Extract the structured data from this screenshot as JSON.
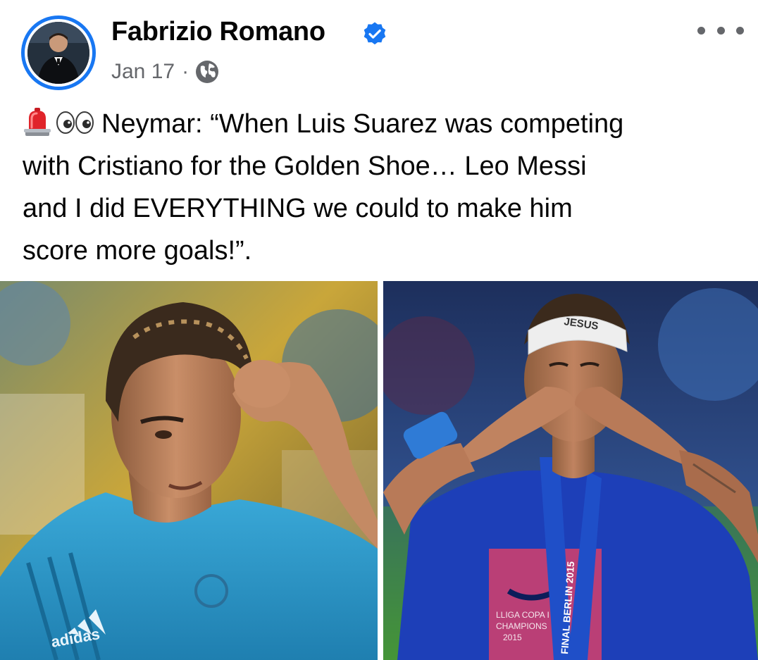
{
  "post": {
    "author": {
      "name": "Fabrizio Romano",
      "verified": true
    },
    "meta": {
      "date": "Jan 17",
      "separator": "·",
      "audience_icon": "globe-icon"
    },
    "more_icon": "more-options-icon",
    "text": {
      "emojis": [
        "siren-emoji",
        "eyes-emoji"
      ],
      "line1": "Neymar: “When Luis Suarez was competing",
      "line2": "with Cristiano for the Golden Shoe… Leo Messi",
      "line3": "and I did EVERYTHING we could to make him",
      "line4": "score more goals!”."
    },
    "photos": {
      "left": {
        "subject": "player-in-light-blue-kit-photo",
        "shirt_brand": "adidas"
      },
      "right": {
        "subject": "player-blowing-kiss-with-medal-photo",
        "headband_text": "JESUS",
        "lanyard_text": "FINAL BERLIN 2015",
        "shirt_text_lines": [
          "LLIGA COPA I",
          "CHAMPIONS",
          "2015"
        ]
      }
    },
    "colors": {
      "accent": "#1877f2",
      "secondary_text": "#65676b",
      "primary_text": "#050505"
    }
  }
}
